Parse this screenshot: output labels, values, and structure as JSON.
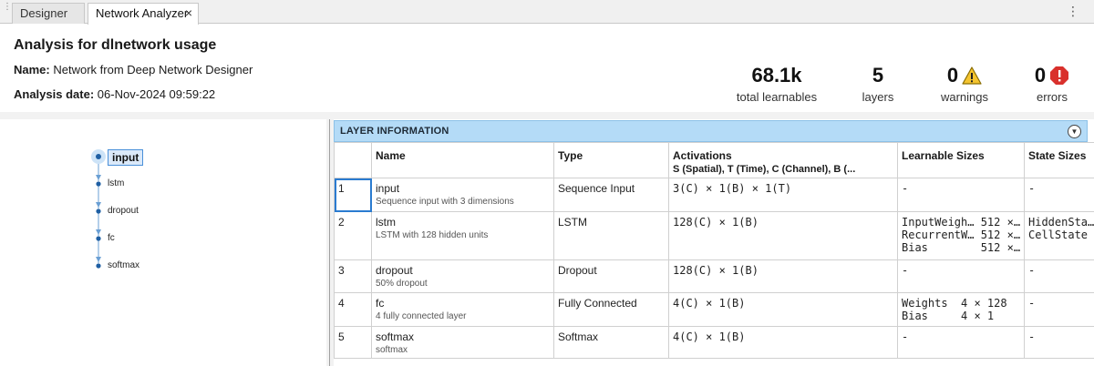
{
  "tabs": [
    {
      "label": "Designer"
    },
    {
      "label": "Network Analyzer",
      "close": "×"
    }
  ],
  "header": {
    "title": "Analysis for dlnetwork usage",
    "name_label": "Name:",
    "name_value": "Network from Deep Network Designer",
    "date_label": "Analysis date:",
    "date_value": "06-Nov-2024 09:59:22"
  },
  "stats": {
    "learnables": {
      "value": "68.1k",
      "label": "total learnables"
    },
    "layers": {
      "value": "5",
      "label": "layers"
    },
    "warnings": {
      "value": "0",
      "label": "warnings",
      "icon": "warning-icon",
      "color": "#f4c430"
    },
    "errors": {
      "value": "0",
      "label": "errors",
      "icon": "error-icon",
      "color": "#d9302c"
    }
  },
  "graph": {
    "nodes": [
      "input",
      "lstm",
      "dropout",
      "fc",
      "softmax"
    ],
    "selected": "input",
    "node_color": "#1f5fa3",
    "edge_color": "#6a9fd4"
  },
  "panel": {
    "title": "LAYER INFORMATION"
  },
  "table": {
    "columns": {
      "name": "Name",
      "type": "Type",
      "activations": "Activations",
      "activations_sub": "S (Spatial), T (Time), C (Channel), B (...",
      "learnable": "Learnable Sizes",
      "state": "State Sizes"
    },
    "rows": [
      {
        "idx": "1",
        "name": "input",
        "desc": "Sequence input with 3 dimensions",
        "type": "Sequence Input",
        "act": "3(C) × 1(B) × 1(T)",
        "learn": [
          "-"
        ],
        "state": [
          "-"
        ]
      },
      {
        "idx": "2",
        "name": "lstm",
        "desc": "LSTM with 128 hidden units",
        "type": "LSTM",
        "act": "128(C) × 1(B)",
        "learn": [
          "InputWeigh… 512 ×…",
          "RecurrentW… 512 ×…",
          "Bias        512 ×…"
        ],
        "state": [
          "HiddenSta…",
          "CellState"
        ]
      },
      {
        "idx": "3",
        "name": "dropout",
        "desc": "50% dropout",
        "type": "Dropout",
        "act": "128(C) × 1(B)",
        "learn": [
          "-"
        ],
        "state": [
          "-"
        ]
      },
      {
        "idx": "4",
        "name": "fc",
        "desc": "4 fully connected layer",
        "type": "Fully Connected",
        "act": "4(C) × 1(B)",
        "learn": [
          "Weights  4 × 128",
          "Bias     4 × 1"
        ],
        "state": [
          "-"
        ]
      },
      {
        "idx": "5",
        "name": "softmax",
        "desc": "softmax",
        "type": "Softmax",
        "act": "4(C) × 1(B)",
        "learn": [
          "-"
        ],
        "state": [
          "-"
        ]
      }
    ]
  }
}
